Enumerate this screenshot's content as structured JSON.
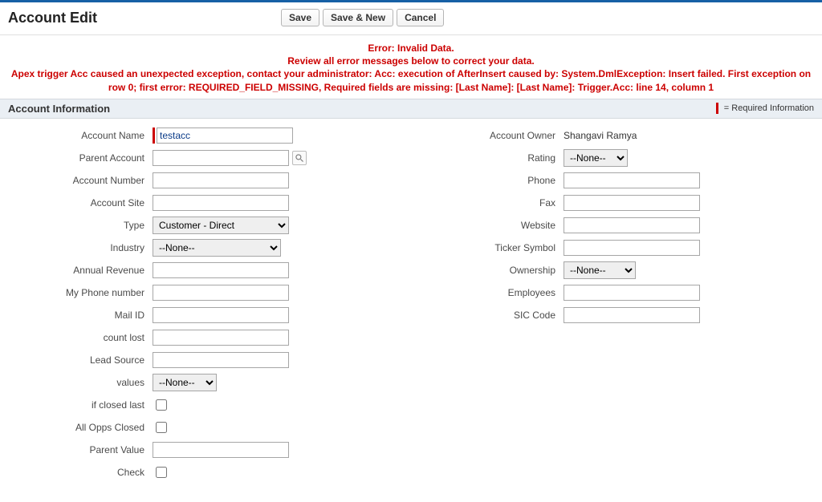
{
  "header": {
    "title": "Account Edit",
    "buttons": {
      "save": "Save",
      "save_new": "Save & New",
      "cancel": "Cancel"
    }
  },
  "error": {
    "line1": "Error: Invalid Data.",
    "line2": "Review all error messages below to correct your data.",
    "line3": "Apex trigger Acc caused an unexpected exception, contact your administrator: Acc: execution of AfterInsert caused by: System.DmlException: Insert failed. First exception on row 0; first error: REQUIRED_FIELD_MISSING, Required fields are missing: [Last Name]: [Last Name]: Trigger.Acc: line 14, column 1"
  },
  "section": {
    "title": "Account Information",
    "required_note": "= Required Information"
  },
  "left": {
    "account_name": {
      "label": "Account Name",
      "value": "testacc"
    },
    "parent_account": {
      "label": "Parent Account",
      "value": ""
    },
    "account_number": {
      "label": "Account Number",
      "value": ""
    },
    "account_site": {
      "label": "Account Site",
      "value": ""
    },
    "type": {
      "label": "Type",
      "value": "Customer - Direct"
    },
    "industry": {
      "label": "Industry",
      "value": "--None--"
    },
    "annual_revenue": {
      "label": "Annual Revenue",
      "value": ""
    },
    "my_phone": {
      "label": "My Phone number",
      "value": ""
    },
    "mail_id": {
      "label": "Mail ID",
      "value": ""
    },
    "count_lost": {
      "label": "count lost",
      "value": ""
    },
    "lead_source": {
      "label": "Lead Source",
      "value": ""
    },
    "values": {
      "label": "values",
      "value": "--None--"
    },
    "if_closed_last": {
      "label": "if closed last"
    },
    "all_opps_closed": {
      "label": "All Opps Closed"
    },
    "parent_value": {
      "label": "Parent Value",
      "value": ""
    },
    "check": {
      "label": "Check"
    }
  },
  "right": {
    "owner": {
      "label": "Account Owner",
      "value": "Shangavi Ramya"
    },
    "rating": {
      "label": "Rating",
      "value": "--None--"
    },
    "phone": {
      "label": "Phone",
      "value": ""
    },
    "fax": {
      "label": "Fax",
      "value": ""
    },
    "website": {
      "label": "Website",
      "value": ""
    },
    "ticker": {
      "label": "Ticker Symbol",
      "value": ""
    },
    "ownership": {
      "label": "Ownership",
      "value": "--None--"
    },
    "employees": {
      "label": "Employees",
      "value": ""
    },
    "sic": {
      "label": "SIC Code",
      "value": ""
    }
  }
}
